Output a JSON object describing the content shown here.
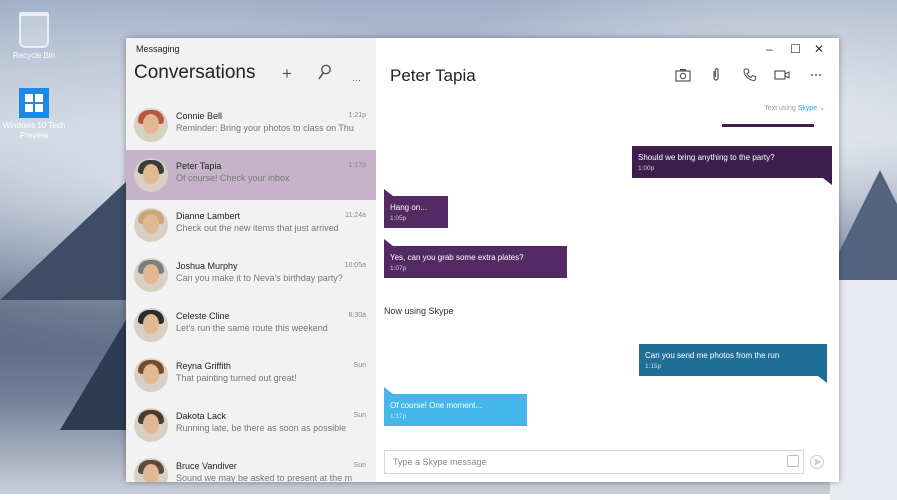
{
  "desktop": {
    "icons": [
      {
        "label": "Recycle Bin"
      },
      {
        "label": "Windows 10 Tech Preview"
      }
    ]
  },
  "window": {
    "app_title": "Messaging",
    "controls": {
      "minimize": "–",
      "maximize": "☐",
      "close": "✕"
    }
  },
  "sidebar": {
    "header": "Conversations",
    "new_label": "+",
    "more_label": "···",
    "conversations": [
      {
        "name": "Connie Bell",
        "time": "1:21p",
        "preview": "Reminder: Bring your photos to class on Thu",
        "selected": false,
        "avatar_color": "#b8573e"
      },
      {
        "name": "Peter Tapia",
        "time": "1:17p",
        "preview": "Of course! Check your inbox",
        "selected": true,
        "avatar_color": "#3b3b3b"
      },
      {
        "name": "Dianne Lambert",
        "time": "11:24a",
        "preview": "Check out the new items that just arrived",
        "selected": false,
        "avatar_color": "#c9a67a"
      },
      {
        "name": "Joshua Murphy",
        "time": "10:05a",
        "preview": "Can you make it to Neva's birthday party?",
        "selected": false,
        "avatar_color": "#7d7d7d"
      },
      {
        "name": "Celeste Cline",
        "time": "8:30a",
        "preview": "Let's run the same route this weekend",
        "selected": false,
        "avatar_color": "#2b2b2b"
      },
      {
        "name": "Reyna Griffith",
        "time": "Sun",
        "preview": "That painting turned out great!",
        "selected": false,
        "avatar_color": "#7a4a2e"
      },
      {
        "name": "Dakota Lack",
        "time": "Sun",
        "preview": "Running late, be there as soon as possible",
        "selected": false,
        "avatar_color": "#4a3a30"
      },
      {
        "name": "Bruce Vandiver",
        "time": "Sun",
        "preview": "Sound we may be asked to present at the m",
        "selected": false,
        "avatar_color": "#5c4a3e"
      }
    ]
  },
  "chat": {
    "contact_name": "Peter Tapia",
    "texting_prefix": "Text using",
    "texting_service": "Skype",
    "messages": [
      {
        "id": "m1",
        "text": "Should we bring anything to the party?",
        "time": "1:00p"
      },
      {
        "id": "m2",
        "text": "Hang on...",
        "time": "1:05p"
      },
      {
        "id": "m3",
        "text": "Yes, can you grab some extra plates?",
        "time": "1:07p"
      },
      {
        "id": "m4",
        "text": "Can you send me photos from the run",
        "time": "1:15p"
      },
      {
        "id": "m5",
        "text": "Of course!  One moment...",
        "time": "1:17p"
      }
    ],
    "system_note": "Now using Skype",
    "composer": {
      "placeholder": "Type a Skype message"
    }
  },
  "colors": {
    "selected_row": "#c5b4c8",
    "bubble_purple": "#532a63",
    "bubble_dark_purple": "#3d1e4d",
    "bubble_blue": "#1f6f98",
    "bubble_light_blue": "#45b6ea",
    "skype_blue": "#2ea2e0"
  }
}
